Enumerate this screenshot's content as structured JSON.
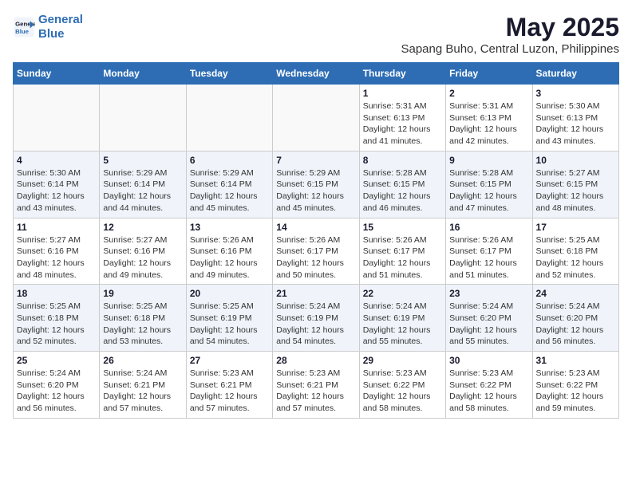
{
  "header": {
    "logo_line1": "General",
    "logo_line2": "Blue",
    "title": "May 2025",
    "subtitle": "Sapang Buho, Central Luzon, Philippines"
  },
  "columns": [
    "Sunday",
    "Monday",
    "Tuesday",
    "Wednesday",
    "Thursday",
    "Friday",
    "Saturday"
  ],
  "weeks": [
    [
      {
        "day": "",
        "detail": ""
      },
      {
        "day": "",
        "detail": ""
      },
      {
        "day": "",
        "detail": ""
      },
      {
        "day": "",
        "detail": ""
      },
      {
        "day": "1",
        "detail": "Sunrise: 5:31 AM\nSunset: 6:13 PM\nDaylight: 12 hours\nand 41 minutes."
      },
      {
        "day": "2",
        "detail": "Sunrise: 5:31 AM\nSunset: 6:13 PM\nDaylight: 12 hours\nand 42 minutes."
      },
      {
        "day": "3",
        "detail": "Sunrise: 5:30 AM\nSunset: 6:13 PM\nDaylight: 12 hours\nand 43 minutes."
      }
    ],
    [
      {
        "day": "4",
        "detail": "Sunrise: 5:30 AM\nSunset: 6:14 PM\nDaylight: 12 hours\nand 43 minutes."
      },
      {
        "day": "5",
        "detail": "Sunrise: 5:29 AM\nSunset: 6:14 PM\nDaylight: 12 hours\nand 44 minutes."
      },
      {
        "day": "6",
        "detail": "Sunrise: 5:29 AM\nSunset: 6:14 PM\nDaylight: 12 hours\nand 45 minutes."
      },
      {
        "day": "7",
        "detail": "Sunrise: 5:29 AM\nSunset: 6:15 PM\nDaylight: 12 hours\nand 45 minutes."
      },
      {
        "day": "8",
        "detail": "Sunrise: 5:28 AM\nSunset: 6:15 PM\nDaylight: 12 hours\nand 46 minutes."
      },
      {
        "day": "9",
        "detail": "Sunrise: 5:28 AM\nSunset: 6:15 PM\nDaylight: 12 hours\nand 47 minutes."
      },
      {
        "day": "10",
        "detail": "Sunrise: 5:27 AM\nSunset: 6:15 PM\nDaylight: 12 hours\nand 48 minutes."
      }
    ],
    [
      {
        "day": "11",
        "detail": "Sunrise: 5:27 AM\nSunset: 6:16 PM\nDaylight: 12 hours\nand 48 minutes."
      },
      {
        "day": "12",
        "detail": "Sunrise: 5:27 AM\nSunset: 6:16 PM\nDaylight: 12 hours\nand 49 minutes."
      },
      {
        "day": "13",
        "detail": "Sunrise: 5:26 AM\nSunset: 6:16 PM\nDaylight: 12 hours\nand 49 minutes."
      },
      {
        "day": "14",
        "detail": "Sunrise: 5:26 AM\nSunset: 6:17 PM\nDaylight: 12 hours\nand 50 minutes."
      },
      {
        "day": "15",
        "detail": "Sunrise: 5:26 AM\nSunset: 6:17 PM\nDaylight: 12 hours\nand 51 minutes."
      },
      {
        "day": "16",
        "detail": "Sunrise: 5:26 AM\nSunset: 6:17 PM\nDaylight: 12 hours\nand 51 minutes."
      },
      {
        "day": "17",
        "detail": "Sunrise: 5:25 AM\nSunset: 6:18 PM\nDaylight: 12 hours\nand 52 minutes."
      }
    ],
    [
      {
        "day": "18",
        "detail": "Sunrise: 5:25 AM\nSunset: 6:18 PM\nDaylight: 12 hours\nand 52 minutes."
      },
      {
        "day": "19",
        "detail": "Sunrise: 5:25 AM\nSunset: 6:18 PM\nDaylight: 12 hours\nand 53 minutes."
      },
      {
        "day": "20",
        "detail": "Sunrise: 5:25 AM\nSunset: 6:19 PM\nDaylight: 12 hours\nand 54 minutes."
      },
      {
        "day": "21",
        "detail": "Sunrise: 5:24 AM\nSunset: 6:19 PM\nDaylight: 12 hours\nand 54 minutes."
      },
      {
        "day": "22",
        "detail": "Sunrise: 5:24 AM\nSunset: 6:19 PM\nDaylight: 12 hours\nand 55 minutes."
      },
      {
        "day": "23",
        "detail": "Sunrise: 5:24 AM\nSunset: 6:20 PM\nDaylight: 12 hours\nand 55 minutes."
      },
      {
        "day": "24",
        "detail": "Sunrise: 5:24 AM\nSunset: 6:20 PM\nDaylight: 12 hours\nand 56 minutes."
      }
    ],
    [
      {
        "day": "25",
        "detail": "Sunrise: 5:24 AM\nSunset: 6:20 PM\nDaylight: 12 hours\nand 56 minutes."
      },
      {
        "day": "26",
        "detail": "Sunrise: 5:24 AM\nSunset: 6:21 PM\nDaylight: 12 hours\nand 57 minutes."
      },
      {
        "day": "27",
        "detail": "Sunrise: 5:23 AM\nSunset: 6:21 PM\nDaylight: 12 hours\nand 57 minutes."
      },
      {
        "day": "28",
        "detail": "Sunrise: 5:23 AM\nSunset: 6:21 PM\nDaylight: 12 hours\nand 57 minutes."
      },
      {
        "day": "29",
        "detail": "Sunrise: 5:23 AM\nSunset: 6:22 PM\nDaylight: 12 hours\nand 58 minutes."
      },
      {
        "day": "30",
        "detail": "Sunrise: 5:23 AM\nSunset: 6:22 PM\nDaylight: 12 hours\nand 58 minutes."
      },
      {
        "day": "31",
        "detail": "Sunrise: 5:23 AM\nSunset: 6:22 PM\nDaylight: 12 hours\nand 59 minutes."
      }
    ]
  ]
}
